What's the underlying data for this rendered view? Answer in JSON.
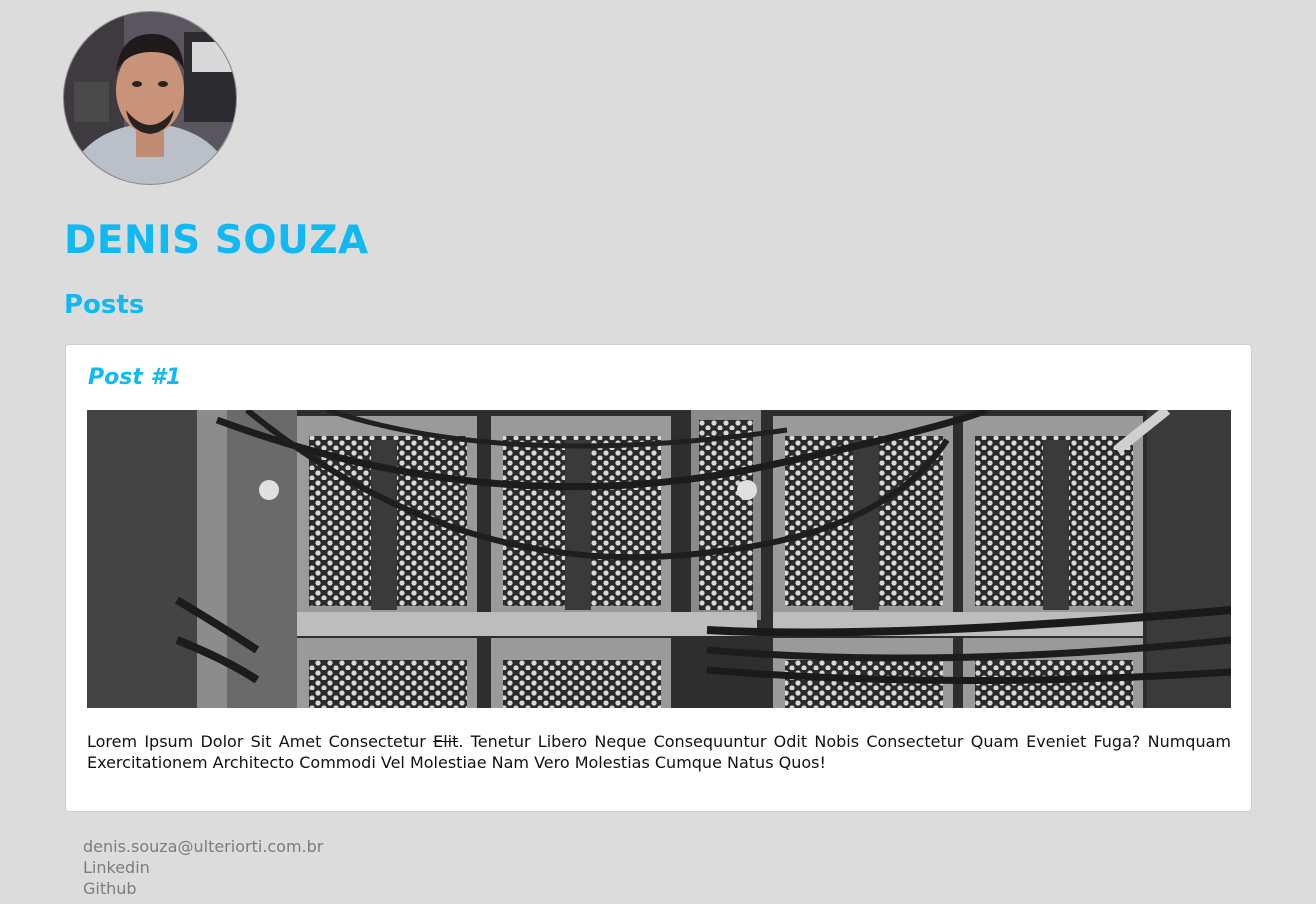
{
  "profile": {
    "name": "DENIS SOUZA",
    "avatar_icon": "profile-photo"
  },
  "posts_section": {
    "title": "Posts"
  },
  "posts": [
    {
      "title": "Post #1",
      "image_icon": "server-rack-photo",
      "body_before": "Lorem Ipsum Dolor Sit Amet Consectetur ",
      "body_struck": "Elit",
      "body_after": ". Tenetur Libero Neque Consequuntur Odit Nobis Consectetur Quam Eveniet Fuga? Numquam Exercitationem Architecto Commodi Vel Molestiae Nam Vero Molestias Cumque Natus Quos!"
    }
  ],
  "footer": {
    "email": "denis.souza@ulteriorti.com.br",
    "linkedin": "Linkedin",
    "github": "Github"
  },
  "colors": {
    "accent": "#10b9f1",
    "background": "#dcdcdc",
    "card": "#ffffff",
    "footer_text": "#7c7c7c"
  }
}
